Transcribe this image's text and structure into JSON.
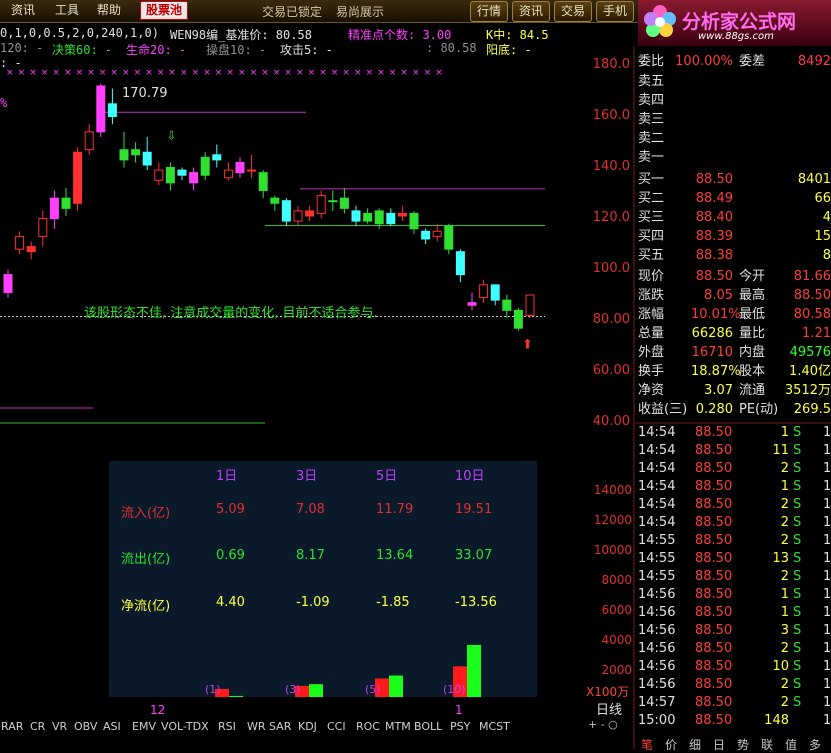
{
  "toolbar": {
    "items": [
      "资讯",
      "工具",
      "帮助",
      "股票池"
    ],
    "active": "股票池",
    "status1": "交易已锁定",
    "status2": "易尚展示",
    "right_buttons": [
      "行情",
      "资讯",
      "交易",
      "手机"
    ]
  },
  "logo": {
    "title": "分析家公式网",
    "url": "www.88gs.com"
  },
  "indicator": {
    "line1_params": "0,1,0,0.5,2,0,240,1,0)",
    "line1_name": "WEN98编_基准价: 80.58",
    "line1_acc": "精准点个数: 3.00",
    "line1_k": "K中: 84.5",
    "line2_a": "120: -",
    "line2_b": "决策60: -",
    "line2_c": "生命20: -",
    "line2_d": "操盘10: -",
    "line2_e": "攻击5: -",
    "line2_f": ": 80.58",
    "line2_g": "阳底: -",
    "line3": ": -",
    "pct_mark": "%",
    "high_label": "170.79",
    "advice": "该股形态不佳, 注意成交量的变化, 目前不适合参与."
  },
  "price_axis": [
    "180.0",
    "160.0",
    "140.0",
    "120.0",
    "100.0",
    "80.00",
    "60.00",
    "40.00"
  ],
  "vol_axis": [
    "14000",
    "12000",
    "10000",
    "8000",
    "6000",
    "4000",
    "2000"
  ],
  "vol_unit": "X100万",
  "period": "日线",
  "zoom_controls": "+ - ○",
  "chart_data": {
    "type": "candlestick",
    "unit": "price",
    "candles": [
      {
        "o": 90,
        "c": 97,
        "h": 99,
        "l": 88,
        "up": true
      },
      {
        "o": 107,
        "c": 112,
        "h": 114,
        "l": 105,
        "up": true
      },
      {
        "o": 106,
        "c": 108,
        "h": 110,
        "l": 103,
        "up": true
      },
      {
        "o": 112,
        "c": 119,
        "h": 122,
        "l": 108,
        "up": true
      },
      {
        "o": 119,
        "c": 127,
        "h": 130,
        "l": 115,
        "up": true
      },
      {
        "o": 127,
        "c": 123,
        "h": 131,
        "l": 120,
        "up": false
      },
      {
        "o": 125,
        "c": 145,
        "h": 147,
        "l": 122,
        "up": true
      },
      {
        "o": 146,
        "c": 153,
        "h": 156,
        "l": 144,
        "up": true
      },
      {
        "o": 153,
        "c": 171,
        "h": 172,
        "l": 151,
        "up": true
      },
      {
        "o": 164,
        "c": 159,
        "h": 170,
        "l": 156,
        "up": false
      },
      {
        "o": 146,
        "c": 142,
        "h": 153,
        "l": 139,
        "up": false
      },
      {
        "o": 144,
        "c": 146,
        "h": 149,
        "l": 141,
        "up": false
      },
      {
        "o": 145,
        "c": 140,
        "h": 151,
        "l": 138,
        "up": false
      },
      {
        "o": 134,
        "c": 138,
        "h": 141,
        "l": 132,
        "up": true
      },
      {
        "o": 139,
        "c": 133,
        "h": 141,
        "l": 130,
        "up": false
      },
      {
        "o": 138,
        "c": 136,
        "h": 139,
        "l": 134,
        "up": false
      },
      {
        "o": 137,
        "c": 133,
        "h": 139,
        "l": 130,
        "up": true
      },
      {
        "o": 136,
        "c": 143,
        "h": 145,
        "l": 134,
        "up": false
      },
      {
        "o": 142,
        "c": 144,
        "h": 148,
        "l": 139,
        "up": false
      },
      {
        "o": 135,
        "c": 138,
        "h": 141,
        "l": 134,
        "up": true
      },
      {
        "o": 137,
        "c": 141,
        "h": 143,
        "l": 135,
        "up": true
      },
      {
        "o": 138,
        "c": 138,
        "h": 144,
        "l": 135,
        "up": true
      },
      {
        "o": 137,
        "c": 130,
        "h": 138,
        "l": 127,
        "up": false
      },
      {
        "o": 127,
        "c": 125,
        "h": 128,
        "l": 122,
        "up": false
      },
      {
        "o": 126,
        "c": 118,
        "h": 127,
        "l": 116,
        "up": false
      },
      {
        "o": 122,
        "c": 118,
        "h": 124,
        "l": 116,
        "up": true
      },
      {
        "o": 120,
        "c": 122,
        "h": 124,
        "l": 118,
        "up": true
      },
      {
        "o": 121,
        "c": 128,
        "h": 130,
        "l": 119,
        "up": true
      },
      {
        "o": 126,
        "c": 126,
        "h": 130,
        "l": 122,
        "up": false
      },
      {
        "o": 127,
        "c": 123,
        "h": 131,
        "l": 121,
        "up": false
      },
      {
        "o": 122,
        "c": 118,
        "h": 124,
        "l": 116,
        "up": false
      },
      {
        "o": 118,
        "c": 121,
        "h": 123,
        "l": 117,
        "up": false
      },
      {
        "o": 122,
        "c": 117,
        "h": 123,
        "l": 115,
        "up": false
      },
      {
        "o": 121,
        "c": 117,
        "h": 123,
        "l": 116,
        "up": false
      },
      {
        "o": 121,
        "c": 120,
        "h": 124,
        "l": 118,
        "up": true
      },
      {
        "o": 121,
        "c": 115,
        "h": 122,
        "l": 113,
        "up": false
      },
      {
        "o": 114,
        "c": 111,
        "h": 115,
        "l": 109,
        "up": false
      },
      {
        "o": 112,
        "c": 114,
        "h": 117,
        "l": 110,
        "up": true
      },
      {
        "o": 116,
        "c": 107,
        "h": 117,
        "l": 105,
        "up": false
      },
      {
        "o": 106,
        "c": 97,
        "h": 107,
        "l": 94,
        "up": false
      },
      {
        "o": 86,
        "c": 85,
        "h": 90,
        "l": 83,
        "up": true
      },
      {
        "o": 88,
        "c": 93,
        "h": 95,
        "l": 86,
        "up": true
      },
      {
        "o": 93,
        "c": 87,
        "h": 93,
        "l": 85,
        "up": false
      },
      {
        "o": 87,
        "c": 83,
        "h": 89,
        "l": 80,
        "up": false
      },
      {
        "o": 83,
        "c": 76,
        "h": 84,
        "l": 75,
        "up": false
      },
      {
        "o": 81,
        "c": 89,
        "h": 89,
        "l": 80,
        "up": true
      }
    ],
    "resistance": [
      165,
      133,
      119
    ],
    "support": 80.58,
    "ylim": [
      40,
      182
    ]
  },
  "quote": {
    "weibi_label": "委比",
    "weibi": "100.00%",
    "weicha_label": "委差",
    "weicha": "8492",
    "sells": [
      {
        "label": "卖五",
        "price": "",
        "vol": ""
      },
      {
        "label": "卖四",
        "price": "",
        "vol": ""
      },
      {
        "label": "卖三",
        "price": "",
        "vol": ""
      },
      {
        "label": "卖二",
        "price": "",
        "vol": ""
      },
      {
        "label": "卖一",
        "price": "",
        "vol": ""
      }
    ],
    "buys": [
      {
        "label": "买一",
        "price": "88.50",
        "vol": "8401"
      },
      {
        "label": "买二",
        "price": "88.49",
        "vol": "66"
      },
      {
        "label": "买三",
        "price": "88.40",
        "vol": "4"
      },
      {
        "label": "买四",
        "price": "88.39",
        "vol": "15"
      },
      {
        "label": "买五",
        "price": "88.38",
        "vol": "8"
      }
    ],
    "stats": [
      {
        "l1": "现价",
        "v1": "88.50",
        "l2": "今开",
        "v2": "81.66",
        "c1": "#ff3c3c",
        "c2": "#ff3c3c"
      },
      {
        "l1": "涨跌",
        "v1": "8.05",
        "l2": "最高",
        "v2": "88.50",
        "c1": "#ff3c3c",
        "c2": "#ff3c3c"
      },
      {
        "l1": "涨幅",
        "v1": "10.01%",
        "l2": "最低",
        "v2": "80.58",
        "c1": "#ff3c3c",
        "c2": "#ff3c3c"
      },
      {
        "l1": "总量",
        "v1": "66286",
        "l2": "量比",
        "v2": "1.21",
        "c1": "#ffff40",
        "c2": "#ff3c3c"
      },
      {
        "l1": "外盘",
        "v1": "16710",
        "l2": "内盘",
        "v2": "49576",
        "c1": "#ff3c3c",
        "c2": "#30ff30"
      },
      {
        "l1": "换手",
        "v1": "18.87%",
        "l2": "股本",
        "v2": "1.40亿",
        "c1": "#ffff40",
        "c2": "#ffff40"
      },
      {
        "l1": "净资",
        "v1": "3.07",
        "l2": "流通",
        "v2": "3512万",
        "c1": "#ffff40",
        "c2": "#ffff40"
      },
      {
        "l1": "收益(三)",
        "v1": "0.280",
        "l2": "PE(动)",
        "v2": "269.5",
        "c1": "#ffff40",
        "c2": "#ffff40"
      }
    ]
  },
  "ticks": [
    {
      "t": "14:54",
      "p": "88.50",
      "v": "1",
      "s": "S",
      "n": "1"
    },
    {
      "t": "14:54",
      "p": "88.50",
      "v": "11",
      "s": "S",
      "n": "1"
    },
    {
      "t": "14:54",
      "p": "88.50",
      "v": "2",
      "s": "S",
      "n": "1"
    },
    {
      "t": "14:54",
      "p": "88.50",
      "v": "1",
      "s": "S",
      "n": "1"
    },
    {
      "t": "14:54",
      "p": "88.50",
      "v": "2",
      "s": "S",
      "n": "1"
    },
    {
      "t": "14:54",
      "p": "88.50",
      "v": "2",
      "s": "S",
      "n": "1"
    },
    {
      "t": "14:55",
      "p": "88.50",
      "v": "2",
      "s": "S",
      "n": "1"
    },
    {
      "t": "14:55",
      "p": "88.50",
      "v": "13",
      "s": "S",
      "n": "1"
    },
    {
      "t": "14:55",
      "p": "88.50",
      "v": "2",
      "s": "S",
      "n": "1"
    },
    {
      "t": "14:56",
      "p": "88.50",
      "v": "1",
      "s": "S",
      "n": "1"
    },
    {
      "t": "14:56",
      "p": "88.50",
      "v": "1",
      "s": "S",
      "n": "1"
    },
    {
      "t": "14:56",
      "p": "88.50",
      "v": "3",
      "s": "S",
      "n": "1"
    },
    {
      "t": "14:56",
      "p": "88.50",
      "v": "2",
      "s": "S",
      "n": "1"
    },
    {
      "t": "14:56",
      "p": "88.50",
      "v": "10",
      "s": "S",
      "n": "1"
    },
    {
      "t": "14:56",
      "p": "88.50",
      "v": "2",
      "s": "S",
      "n": "1"
    },
    {
      "t": "14:57",
      "p": "88.50",
      "v": "2",
      "s": "S",
      "n": "1"
    },
    {
      "t": "15:00",
      "p": "88.50",
      "v": "148",
      "s": "",
      "n": "1"
    }
  ],
  "flow": {
    "headers": [
      "1日",
      "3日",
      "5日",
      "10日"
    ],
    "rows": [
      {
        "label": "流入(亿)",
        "values": [
          "5.09",
          "7.08",
          "11.79",
          "19.51"
        ],
        "color": "#e03030"
      },
      {
        "label": "流出(亿)",
        "values": [
          "0.69",
          "8.17",
          "13.64",
          "33.07"
        ],
        "color": "#30e030"
      },
      {
        "label": "净流(亿)",
        "values": [
          "4.40",
          "-1.09",
          "-1.85",
          "-13.56"
        ],
        "color": "#ffff40"
      }
    ],
    "bar_labels": [
      "(1)",
      "(3)",
      "(5)",
      "(10)"
    ],
    "bars_in": [
      5.09,
      7.08,
      11.79,
      19.51
    ],
    "bars_out": [
      0.69,
      8.17,
      13.64,
      33.07
    ]
  },
  "date_marks": [
    "12",
    "1"
  ],
  "bottom_tabs": [
    "RAR",
    "CR",
    "VR",
    "OBV",
    "ASI",
    "EMV",
    "VOL-TDX",
    "RSI",
    "WR",
    "SAR",
    "KDJ",
    "CCI",
    "ROC",
    "MTM",
    "BOLL",
    "PSY",
    "MCST"
  ],
  "bottom_nav": [
    "笔",
    "价",
    "细",
    "日",
    "势",
    "联",
    "值",
    "多"
  ]
}
